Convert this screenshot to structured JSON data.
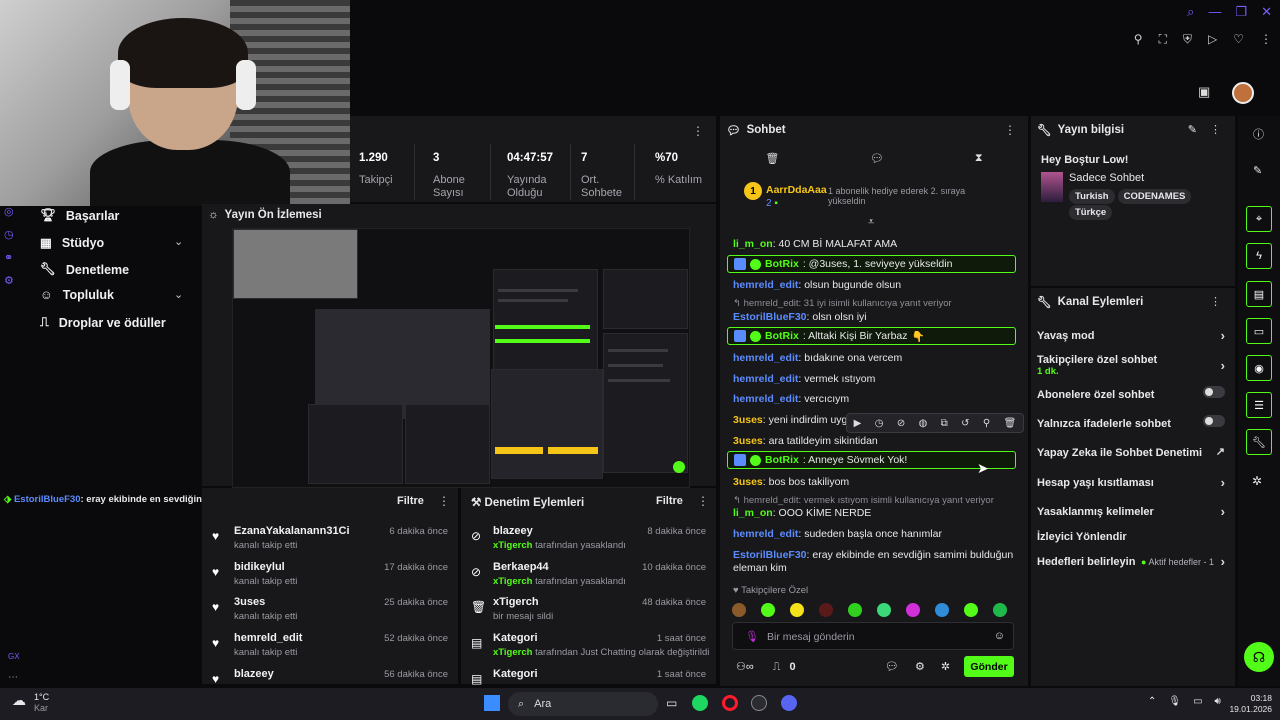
{
  "webcam": {},
  "nav": {
    "items": [
      {
        "label": "Başarılar",
        "icon": "trophy-icon"
      },
      {
        "label": "Stüdyo",
        "icon": "studio-icon"
      },
      {
        "label": "Denetleme",
        "icon": "wrench-icon"
      },
      {
        "label": "Topluluk",
        "icon": "community-icon"
      },
      {
        "label": "Droplar ve ödüller",
        "icon": "gift-icon"
      }
    ]
  },
  "stats": [
    {
      "value": "1.290",
      "label": "Takipçi"
    },
    {
      "value": "3",
      "label": "Abone Sayısı"
    },
    {
      "value": "04:47:57",
      "label": "Yayında Olduğu"
    },
    {
      "value": "7",
      "label": "Ort. Sohbete"
    },
    {
      "value": "%70",
      "label": "% Katılım"
    }
  ],
  "preview": {
    "title": "Yayın Ön İzlemesi"
  },
  "ticker": {
    "user": "EstorilBlueF30",
    "text": ": eray ekibinde en sevdiğin samimi bulduğun eleman kim"
  },
  "followers": {
    "title": "Filtre",
    "rows": [
      {
        "name": "EzanaYakalanann31Ci",
        "sub": "kanalı takip etti",
        "time": "6 dakika önce"
      },
      {
        "name": "bidikeylul",
        "sub": "kanalı takip etti",
        "time": "17 dakika önce"
      },
      {
        "name": "3uses",
        "sub": "kanalı takip etti",
        "time": "25 dakika önce"
      },
      {
        "name": "hemreld_edit",
        "sub": "kanalı takip etti",
        "time": "52 dakika önce"
      },
      {
        "name": "blazeey",
        "sub": "",
        "time": "56 dakika önce"
      }
    ]
  },
  "moderation": {
    "title": "Denetim Eylemleri",
    "filter": "Filtre",
    "rows": [
      {
        "name": "blazeey",
        "actor": "xTigerch",
        "rest": " tarafından yasaklandı",
        "time": "8 dakika önce"
      },
      {
        "name": "Berkaep44",
        "actor": "xTigerch",
        "rest": " tarafından yasaklandı",
        "time": "10 dakika önce"
      },
      {
        "name": "xTigerch",
        "actor": "",
        "rest": "bir mesajı sildi",
        "time": "48 dakika önce"
      },
      {
        "name": "Kategori",
        "actor": "xTigerch",
        "rest": " tarafından Just Chatting olarak değiştirildi",
        "time": "1 saat önce"
      },
      {
        "name": "Kategori",
        "actor": "",
        "rest": "",
        "time": "1 saat önce"
      }
    ]
  },
  "chat": {
    "title": "Sohbet",
    "pinned": {
      "user": "AarrDdaAaa",
      "count": "2",
      "text": "1 abonelik hediye ederek 2. sıraya yükseldin"
    },
    "messages": [
      {
        "user": "li_m_on",
        "text": ": 40 CM Bİ MALAFAT AMA"
      },
      {
        "user": "BotRix",
        "text": ": @3uses, 1. seviyeye yükseldin"
      },
      {
        "user": "hemreld_edit",
        "text": ": olsun bugunde olsun"
      },
      {
        "reply": "hemreld_edit: 31 iyi isimli kullanıcıya yanıt veriyor"
      },
      {
        "user": "EstorilBlueF30",
        "text": ": olsn olsn iyi"
      },
      {
        "user": "BotRix",
        "text": ": Alttaki Kişi Bir Yarbaz"
      },
      {
        "user": "hemreld_edit",
        "text": ": bıdakıne ona vercem"
      },
      {
        "user": "hemreld_edit",
        "text": ": vermek ıstıyom"
      },
      {
        "user": "hemreld_edit",
        "text": ": vercıcıym"
      },
      {
        "user": "3uses",
        "text": ": yeni indirdim uygula"
      },
      {
        "user": "3uses",
        "text": ": ara tatildeyim sikintidan"
      },
      {
        "user": "BotRix",
        "text": ": Anneye Sövmek Yok!"
      },
      {
        "user": "3uses",
        "text": ": bos bos takiliyom"
      },
      {
        "reply": "hemreld_edit: vermek ıstıyom isimli kullanıcıya yanıt veriyor"
      },
      {
        "user": "li_m_on",
        "text": ": OOO KİME NERDE"
      },
      {
        "user": "hemreld_edit",
        "text": ": sudeden başla once hanımlar"
      },
      {
        "user": "EstorilBlueF30",
        "text": ": eray ekibinde en sevdiğin samimi bulduğun eleman kim"
      }
    ],
    "followers_only": "Takipçilere Özel",
    "input_placeholder": "Bir mesaj gönderin",
    "count": "0",
    "send": "Gönder"
  },
  "stream_info": {
    "title": "Yayın bilgisi",
    "stream_title": "Hey Boştur Low!",
    "category": "Sadece Sohbet",
    "tags": [
      "Turkish",
      "CODENAMES",
      "Türkçe"
    ]
  },
  "channel_actions": {
    "title": "Kanal Eylemleri",
    "items": [
      {
        "label": "Yavaş mod",
        "control": "chevron"
      },
      {
        "label": "Takipçilere özel sohbet",
        "sub": "1 dk.",
        "control": "chevron"
      },
      {
        "label": "Abonelere özel sohbet",
        "control": "toggle"
      },
      {
        "label": "Yalnızca ifadelerle sohbet",
        "control": "toggle"
      },
      {
        "label": "Yapay Zeka ile Sohbet Denetimi",
        "control": "external"
      },
      {
        "label": "Hesap yaşı kısıtlaması",
        "control": "chevron"
      },
      {
        "label": "Yasaklanmış kelimeler",
        "control": "chevron"
      },
      {
        "label": "İzleyici Yönlendir",
        "control": "none"
      },
      {
        "label": "Hedefleri belirleyin",
        "badge": "Aktif hedefler - 1",
        "control": "chevron"
      }
    ]
  },
  "taskbar": {
    "weather_temp": "1°C",
    "weather_desc": "Kar",
    "search": "Ara",
    "time": "03:18",
    "date": "19.01.2026"
  },
  "colors": {
    "accent": "#53fc18",
    "panel": "#18181b",
    "link": "#5b8cff"
  }
}
